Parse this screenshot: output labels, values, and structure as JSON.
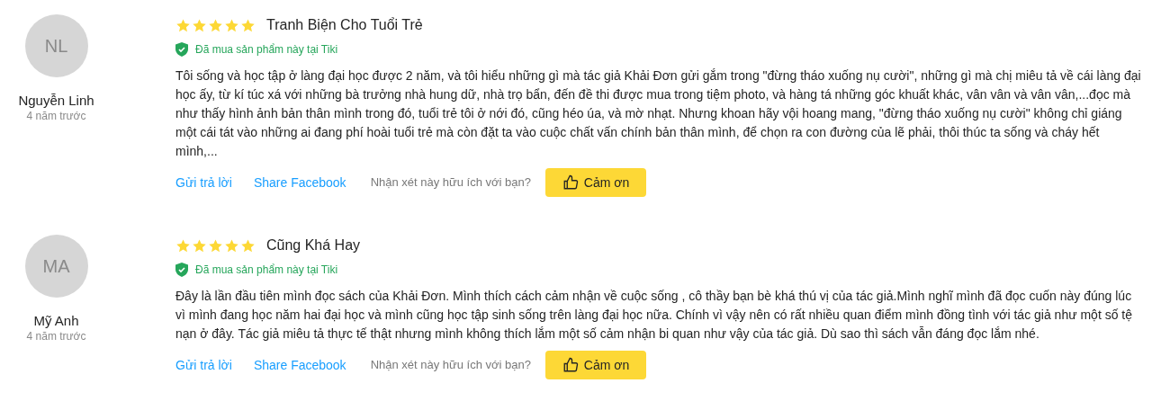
{
  "reviews": [
    {
      "initials": "NL",
      "name": "Nguyễn Linh",
      "time": "4 năm trước",
      "stars": 5,
      "title": "Tranh Biện Cho Tuổi Trẻ",
      "verified": "Đã mua sản phẩm này tại Tiki",
      "body": "Tôi sống và học tập ở làng đại học được 2 năm, và tôi hiểu những gì mà tác giả Khải Đơn gửi gắm trong \"đừng tháo xuống nụ cười\", những gì mà chị miêu tả về cái làng đại học ấy, từ kí túc xá với những bà trưởng nhà hung dữ, nhà trọ bẩn, đến đề thi được mua trong tiệm photo, và hàng tá những góc khuất khác, vân vân và vân vân,...đọc mà như thấy hình ảnh bản thân mình trong đó, tuổi trẻ tôi ở nới đó, cũng héo úa, và mờ nhạt. Nhưng khoan hãy vội hoang mang, \"đừng tháo xuống nụ cười\" không chỉ giáng một cái tát vào những ai đang phí hoài tuổi trẻ mà còn đặt ta vào cuộc chất vấn chính bản thân mình, để chọn ra con đường của lẽ phải, thôi thúc ta sống và cháy hết mình,...",
      "reply": "Gửi trả lời",
      "share": "Share Facebook",
      "helpful": "Nhận xét này hữu ích với bạn?",
      "thanks": "Cảm ơn"
    },
    {
      "initials": "MA",
      "name": "Mỹ Anh",
      "time": "4 năm trước",
      "stars": 5,
      "title": "Cũng Khá Hay",
      "verified": "Đã mua sản phẩm này tại Tiki",
      "body": "Đây là lần đầu tiên mình đọc sách của Khải Đơn. Mình thích cách cảm nhận về cuộc sống , cô thầy bạn bè khá thú vị của tác giả.Mình nghĩ mình đã đọc cuốn này đúng lúc vì mình đang học năm hai đại học và mình cũng học tập sinh sống trên làng đại học nữa. Chính vì vậy nên có rất nhiều quan điểm mình đồng tình với tác giả như một số tệ nạn ở đây. Tác giả miêu tả thực tế thật nhưng mình không thích lắm một số cảm nhận bi quan như vậy của tác giả. Dù sao thì sách vẫn đáng đọc lắm nhé.",
      "reply": "Gửi trả lời",
      "share": "Share Facebook",
      "helpful": "Nhận xét này hữu ích với bạn?",
      "thanks": "Cảm ơn"
    }
  ]
}
